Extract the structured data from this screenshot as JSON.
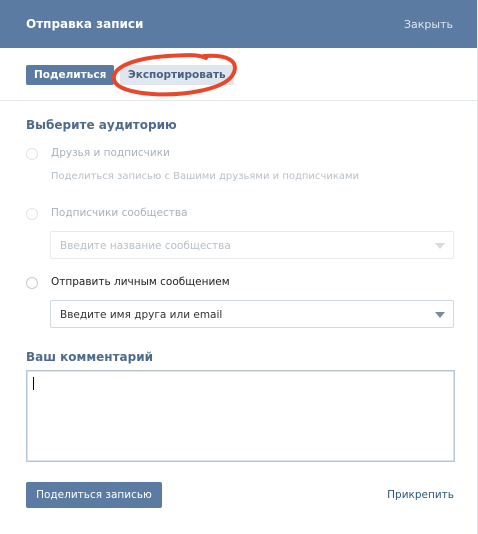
{
  "header": {
    "title": "Отправка записи",
    "close_label": "Закрыть"
  },
  "tabs": [
    {
      "label": "Поделиться",
      "active": true
    },
    {
      "label": "Экспортировать",
      "active": false
    }
  ],
  "audience": {
    "heading": "Выберите аудиторию",
    "options": [
      {
        "label": "Друзья и подписчики",
        "description": "Поделиться записью с Вашими друзьями и подписчиками",
        "enabled": false
      },
      {
        "label": "Подписчики сообщества",
        "select_placeholder": "Введите название сообщества",
        "enabled": false
      },
      {
        "label": "Отправить личным сообщением",
        "select_placeholder": "Введите имя друга или email",
        "enabled": true
      }
    ]
  },
  "comment": {
    "heading": "Ваш комментарий",
    "value": ""
  },
  "footer": {
    "submit_label": "Поделиться записью",
    "attach_label": "Прикрепить"
  },
  "colors": {
    "header_bg": "#5b7ba2",
    "annotation": "#e8472a",
    "link": "#2b587a"
  }
}
